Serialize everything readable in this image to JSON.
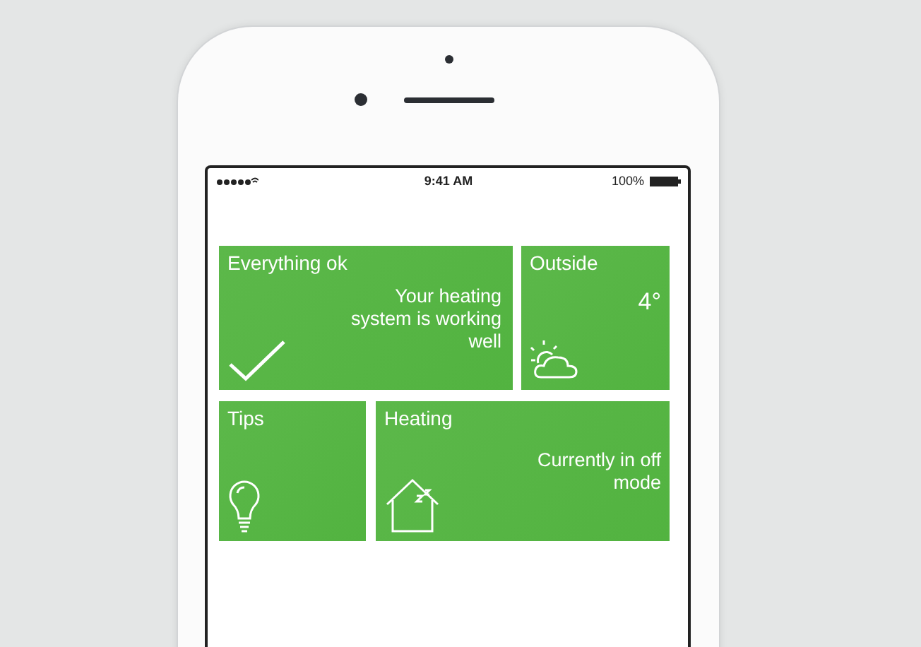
{
  "status_bar": {
    "time": "9:41 AM",
    "battery": "100%"
  },
  "tiles": [
    {
      "kind": "status",
      "title": "Everything ok",
      "message": "Your heating system is working well"
    },
    {
      "kind": "weather",
      "title": "Outside",
      "value": "4°"
    },
    {
      "kind": "tips",
      "title": "Tips"
    },
    {
      "kind": "heating",
      "title": "Heating",
      "message": "Currently in off mode"
    }
  ]
}
